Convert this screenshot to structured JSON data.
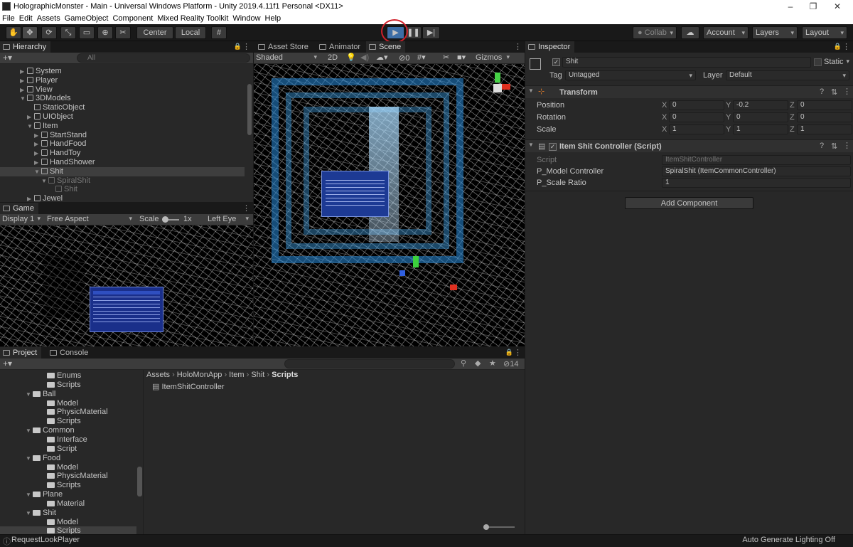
{
  "window": {
    "title": "HolographicMonster - Main - Universal Windows Platform - Unity 2019.4.11f1 Personal <DX11>"
  },
  "menu": [
    "File",
    "Edit",
    "Assets",
    "GameObject",
    "Component",
    "Mixed Reality Toolkit",
    "Window",
    "Help"
  ],
  "toolbar": {
    "center_label": "Center",
    "local_label": "Local",
    "collab_label": "Collab",
    "account_label": "Account",
    "layers_label": "Layers",
    "layout_label": "Layout"
  },
  "hierarchy": {
    "tab": "Hierarchy",
    "search_placeholder": "All",
    "rows": [
      {
        "label": "System",
        "depth": 2,
        "arrow": "▶",
        "sel": false
      },
      {
        "label": "Player",
        "depth": 2,
        "arrow": "▶",
        "sel": false
      },
      {
        "label": "View",
        "depth": 2,
        "arrow": "▶",
        "sel": false
      },
      {
        "label": "3DModels",
        "depth": 2,
        "arrow": "▼",
        "sel": false
      },
      {
        "label": "StaticObject",
        "depth": 3,
        "arrow": "",
        "sel": false
      },
      {
        "label": "UIObject",
        "depth": 3,
        "arrow": "▶",
        "sel": false
      },
      {
        "label": "Item",
        "depth": 3,
        "arrow": "▼",
        "sel": false
      },
      {
        "label": "StartStand",
        "depth": 4,
        "arrow": "▶",
        "sel": false
      },
      {
        "label": "HandFood",
        "depth": 4,
        "arrow": "▶",
        "sel": false
      },
      {
        "label": "HandToy",
        "depth": 4,
        "arrow": "▶",
        "sel": false
      },
      {
        "label": "HandShower",
        "depth": 4,
        "arrow": "▶",
        "sel": false
      },
      {
        "label": "Shit",
        "depth": 4,
        "arrow": "▼",
        "sel": true
      },
      {
        "label": "SpiralShit",
        "depth": 5,
        "arrow": "▼",
        "sel": false,
        "dim": true
      },
      {
        "label": "Shit",
        "depth": 6,
        "arrow": "",
        "sel": false,
        "dim": true
      },
      {
        "label": "Jewel",
        "depth": 3,
        "arrow": "▶",
        "sel": false
      }
    ]
  },
  "game": {
    "tab": "Game",
    "display": "Display 1",
    "aspect": "Free Aspect",
    "scale_label": "Scale",
    "scale_value": "1x",
    "eye": "Left Eye"
  },
  "scene": {
    "tabs": [
      "Asset Store",
      "Animator",
      "Scene"
    ],
    "shading": "Shaded",
    "mode2d": "2D",
    "gizmos": "Gizmos",
    "hidden_count": "0"
  },
  "inspector": {
    "tab": "Inspector",
    "object_name": "Shit",
    "static_label": "Static",
    "tag_label": "Tag",
    "tag_value": "Untagged",
    "layer_label": "Layer",
    "layer_value": "Default",
    "transform": {
      "title": "Transform",
      "rows": [
        {
          "label": "Position",
          "x": "0",
          "y": "-0.2",
          "z": "0"
        },
        {
          "label": "Rotation",
          "x": "0",
          "y": "0",
          "z": "0"
        },
        {
          "label": "Scale",
          "x": "1",
          "y": "1",
          "z": "1"
        }
      ],
      "x": "X",
      "y": "Y",
      "z": "Z"
    },
    "script": {
      "title": "Item Shit Controller (Script)",
      "script_label": "Script",
      "script_value": "ItemShitController",
      "model_label": "P_Model Controller",
      "model_value": "SpiralShit (ItemCommonController)",
      "ratio_label": "P_Scale Ratio",
      "ratio_value": "1"
    },
    "add_component": "Add Component"
  },
  "project": {
    "tabs": [
      "Project",
      "Console"
    ],
    "count": "14",
    "breadcrumb": [
      "Assets",
      "HoloMonApp",
      "Item",
      "Shit",
      "Scripts"
    ],
    "tree": [
      {
        "label": "Enums",
        "depth": 2,
        "arrow": ""
      },
      {
        "label": "Scripts",
        "depth": 2,
        "arrow": ""
      },
      {
        "label": "Ball",
        "depth": 1,
        "arrow": "▼"
      },
      {
        "label": "Model",
        "depth": 2,
        "arrow": ""
      },
      {
        "label": "PhysicMaterial",
        "depth": 2,
        "arrow": ""
      },
      {
        "label": "Scripts",
        "depth": 2,
        "arrow": ""
      },
      {
        "label": "Common",
        "depth": 1,
        "arrow": "▼"
      },
      {
        "label": "Interface",
        "depth": 2,
        "arrow": ""
      },
      {
        "label": "Script",
        "depth": 2,
        "arrow": ""
      },
      {
        "label": "Food",
        "depth": 1,
        "arrow": "▼"
      },
      {
        "label": "Model",
        "depth": 2,
        "arrow": ""
      },
      {
        "label": "PhysicMaterial",
        "depth": 2,
        "arrow": ""
      },
      {
        "label": "Scripts",
        "depth": 2,
        "arrow": ""
      },
      {
        "label": "Plane",
        "depth": 1,
        "arrow": "▼"
      },
      {
        "label": "Material",
        "depth": 2,
        "arrow": ""
      },
      {
        "label": "Shit",
        "depth": 1,
        "arrow": "▼"
      },
      {
        "label": "Model",
        "depth": 2,
        "arrow": ""
      },
      {
        "label": "Scripts",
        "depth": 2,
        "arrow": "",
        "sel": true
      }
    ],
    "files": [
      "ItemShitController"
    ]
  },
  "status": {
    "left": "RequestLookPlayer",
    "right": "Auto Generate Lighting Off"
  },
  "colors": {
    "play_active": "#3d6ea6",
    "highlight_circle": "#d0202a",
    "panel_bg": "#282828"
  }
}
